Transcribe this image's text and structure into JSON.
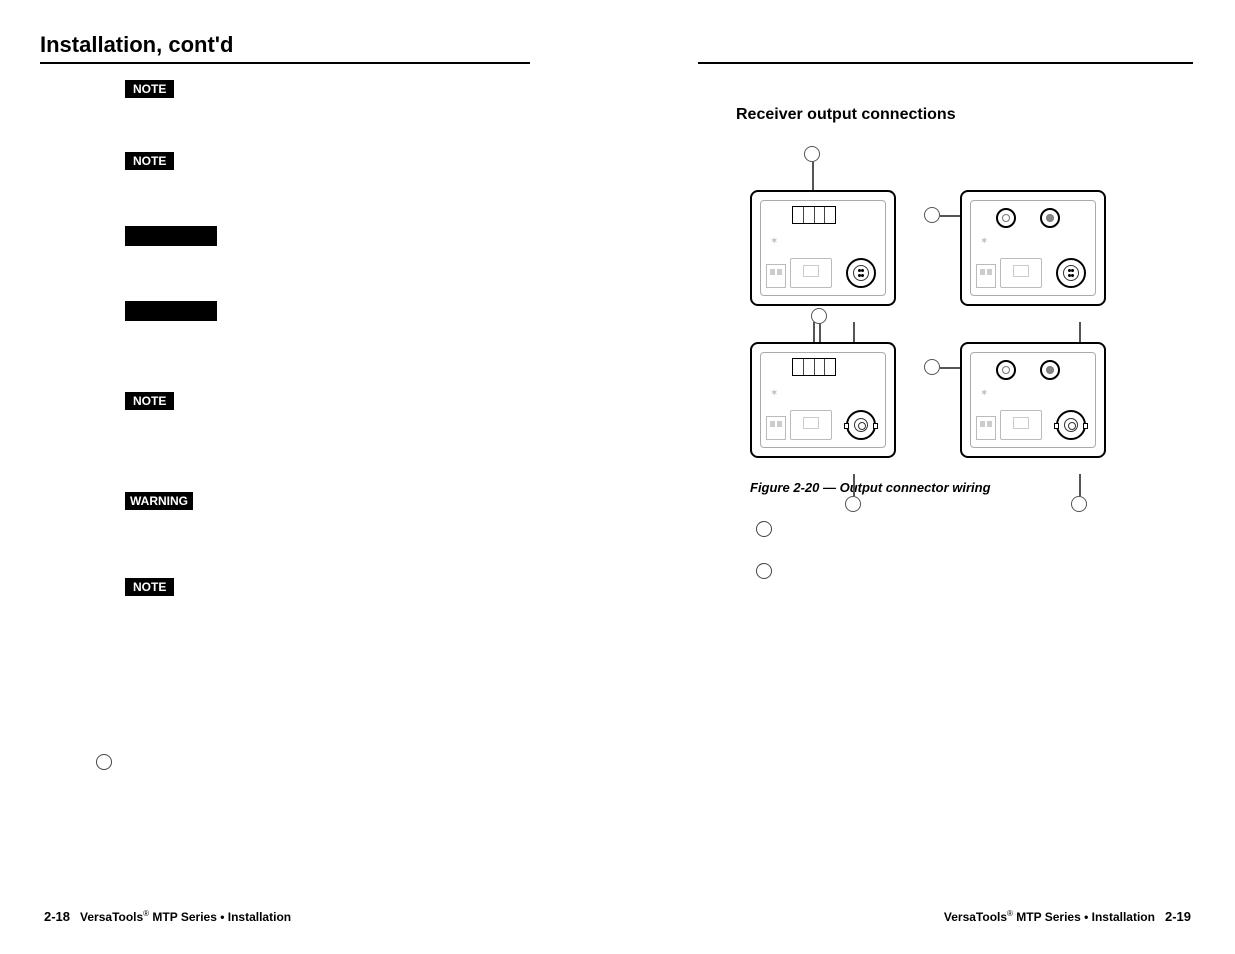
{
  "page": {
    "title": "Installation, cont'd"
  },
  "labels": {
    "note": "NOTE",
    "warning": "WARNING"
  },
  "right": {
    "subsection": "Receiver output connections",
    "figure_caption": "Figure 2-20 — Output connector wiring"
  },
  "footer": {
    "left_page": "2-18",
    "right_page": "2-19",
    "brand": "VersaTools",
    "reg": "®",
    "series": " MTP Series • Installation"
  }
}
